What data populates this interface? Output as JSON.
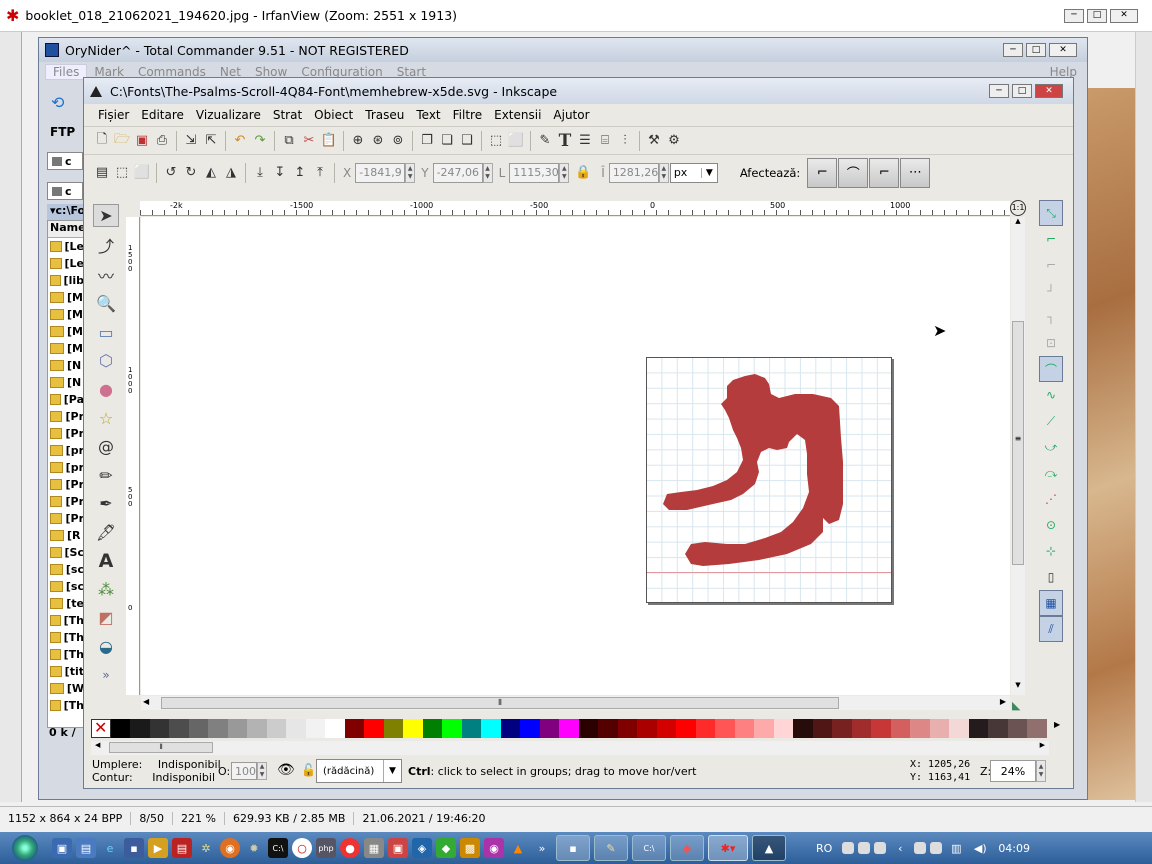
{
  "irfan": {
    "title": "booklet_018_21062021_194620.jpg - IrfanView (Zoom: 2551 x 1913)",
    "status": [
      "1152 x 864 x 24 BPP",
      "8/50",
      "221 %",
      "629.93 KB / 2.85 MB",
      "21.06.2021 / 19:46:20"
    ]
  },
  "tc": {
    "title": "OryNider^ - Total Commander 9.51 - NOT REGISTERED",
    "menu": [
      "Files",
      "Mark",
      "Commands",
      "Net",
      "Show",
      "Configuration",
      "Start"
    ],
    "menu_help": "Help",
    "ftp": "FTP",
    "drive1": "c",
    "drive2": "c",
    "path": "c:\\Fo",
    "header_name": "Name",
    "rows": [
      "[Le",
      "[Le",
      "[lib",
      "[M",
      "[M",
      "[M",
      "[M",
      "[N",
      "[N",
      "[Pa",
      "[Pr",
      "[Pr",
      "[pr",
      "[pr",
      "[Pr",
      "[Pr",
      "[Pr",
      "[R",
      "[Sc",
      "[sc",
      "[sc",
      "[te",
      "[Th",
      "[Th",
      "[Th",
      "[tit",
      "[W",
      "[Th"
    ],
    "footer": "0 k /"
  },
  "ink": {
    "title": "C:\\Fonts\\The-Psalms-Scroll-4Q84-Font\\memhebrew-x5de.svg - Inkscape",
    "menu": [
      "Fișier",
      "Editare",
      "Vizualizare",
      "Strat",
      "Obiect",
      "Traseu",
      "Text",
      "Filtre",
      "Extensii",
      "Ajutor"
    ],
    "x_label": "X",
    "x_value": "-1841,9",
    "y_label": "Y",
    "y_value": "-247,06",
    "w_label": "L",
    "w_value": "1115,30",
    "h_label": "Î",
    "h_value": "1281,26",
    "unit": "px",
    "affect_label": "Afectează:",
    "ruler_labels": [
      "-2k",
      "-1500",
      "-1000",
      "-500",
      "0",
      "500",
      "1000"
    ],
    "vruler_labels": [
      "1500",
      "1000",
      "500",
      "0"
    ],
    "fill_label": "Umplere:",
    "fill_value": "Indisponibil",
    "stroke_label": "Contur:",
    "stroke_value": "Indisponibil",
    "opacity_label": "O:",
    "opacity_value": "100",
    "layer": "(rădăcină)",
    "status_key": "Ctrl",
    "status_msg": ": click to select in groups; drag to move hor/vert",
    "coord_x": "X: 1205,26",
    "coord_y": "Y: 1163,41",
    "zoom_label": "Z:",
    "zoom_value": "24%",
    "glyph_color": "#b43c3c"
  },
  "palette": [
    "#000000",
    "#1a1a1a",
    "#333333",
    "#4d4d4d",
    "#666666",
    "#808080",
    "#999999",
    "#b3b3b3",
    "#cccccc",
    "#e6e6e6",
    "#f2f2f2",
    "#ffffff",
    "#800000",
    "#ff0000",
    "#808000",
    "#ffff00",
    "#008000",
    "#00ff00",
    "#008080",
    "#00ffff",
    "#000080",
    "#0000ff",
    "#800080",
    "#ff00ff",
    "#2b0000",
    "#550000",
    "#800000",
    "#aa0000",
    "#d40000",
    "#ff0000",
    "#ff2a2a",
    "#ff5555",
    "#ff8080",
    "#ffaaaa",
    "#ffd5d5",
    "#280b0b",
    "#501616",
    "#782121",
    "#a02c2c",
    "#c83737",
    "#d35f5f",
    "#de8787",
    "#e9afaf",
    "#f4d7d7",
    "#241c1c",
    "#483737",
    "#6c5353",
    "#916f6f"
  ],
  "taskbar": {
    "lang": "RO",
    "clock": "04:09"
  }
}
